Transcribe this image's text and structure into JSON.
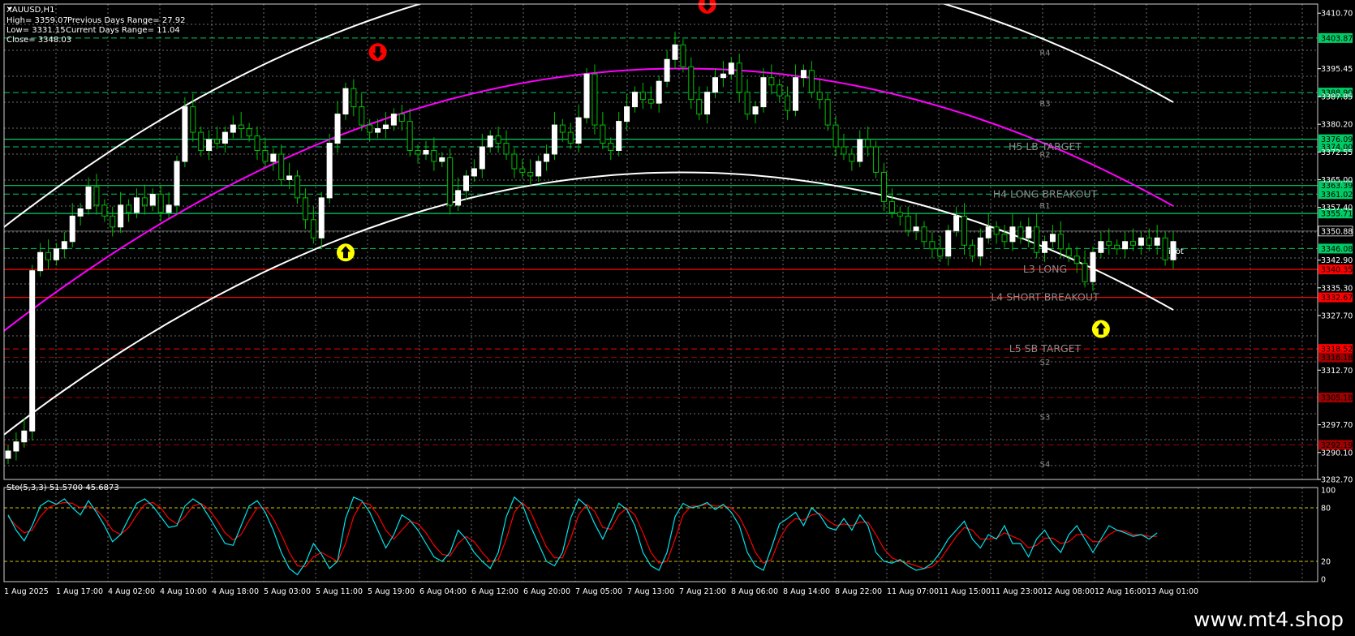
{
  "window": {
    "symbol_title": "XAUUSD,H1"
  },
  "info_panel": {
    "high": "High= 3359.07",
    "prev_range": "Previous Days Range= 27.92",
    "low": "Low= 3331.15",
    "current_range": "Current Days Range= 11.04",
    "close": "Close= 3348.03"
  },
  "indicator": {
    "label": "Sto(5,3,3) 51.5700 45.6873"
  },
  "watermark": "www.mt4.shop",
  "colors": {
    "background": "#000000",
    "grid": "#c8c8c8",
    "candle": "#ffffff",
    "candle_wick": "#00c000",
    "channel_upper": "#ffffff",
    "regression": "#ff00ff",
    "level_green": "#00cc66",
    "level_red": "#ff0000",
    "level_dark_red": "#a00000",
    "stoch_main": "#00e5ee",
    "stoch_signal": "#ff0000",
    "stoch_level": "#c8c800"
  },
  "chart_data": [
    {
      "type": "candlestick",
      "symbol": "XAUUSD",
      "timeframe": "H1",
      "ylim": [
        3282.7,
        3413.2
      ],
      "price_ticks": [
        "3410.70",
        "3395.45",
        "3387.85",
        "3380.20",
        "3372.55",
        "3365.00",
        "3357.40",
        "3342.90",
        "3335.30",
        "3327.70",
        "3312.70",
        "3297.70",
        "3290.10",
        "3282.70"
      ],
      "x_ticks": [
        "1 Aug 2025",
        "1 Aug 17:00",
        "4 Aug 02:00",
        "4 Aug 10:00",
        "4 Aug 18:00",
        "5 Aug 03:00",
        "5 Aug 11:00",
        "5 Aug 19:00",
        "6 Aug 04:00",
        "6 Aug 12:00",
        "6 Aug 20:00",
        "7 Aug 05:00",
        "7 Aug 13:00",
        "7 Aug 21:00",
        "8 Aug 06:00",
        "8 Aug 14:00",
        "8 Aug 22:00",
        "11 Aug 07:00",
        "11 Aug 15:00",
        "11 Aug 23:00",
        "12 Aug 08:00",
        "12 Aug 16:00",
        "13 Aug 01:00"
      ],
      "price_levels": [
        {
          "value": "3403.87",
          "color": "#00cc66",
          "style": "dash"
        },
        {
          "value": "3388.90",
          "color": "#00cc66",
          "style": "dash"
        },
        {
          "value": "3376.09",
          "color": "#00cc66",
          "style": "solid"
        },
        {
          "value": "3374.00",
          "color": "#00cc66",
          "style": "dash"
        },
        {
          "value": "3363.39",
          "color": "#00cc66",
          "style": "solid"
        },
        {
          "value": "3361.02",
          "color": "#00cc66",
          "style": "dash"
        },
        {
          "value": "3355.71",
          "color": "#00cc66",
          "style": "solid"
        },
        {
          "value": "3350.88",
          "color": "#ffffff",
          "style": "current"
        },
        {
          "value": "3346.08",
          "color": "#00cc66",
          "style": "dash"
        },
        {
          "value": "3340.35",
          "color": "#ff0000",
          "style": "solid"
        },
        {
          "value": "3332.67",
          "color": "#ff0000",
          "style": "solid"
        },
        {
          "value": "3318.52",
          "color": "#ff0000",
          "style": "dash"
        },
        {
          "value": "3316.18",
          "color": "#a00000",
          "style": "dash"
        },
        {
          "value": "3305.18",
          "color": "#a00000",
          "style": "dash"
        },
        {
          "value": "3292.19",
          "color": "#a00000",
          "style": "dash"
        }
      ],
      "level_labels": [
        "H5 LB TARGET",
        "H4 LONG BREAKOUT",
        "L3 LONG",
        "L4 SHORT BREAKOUT",
        "L5 SB TARGET"
      ],
      "pivot_labels": [
        "R4",
        "R3",
        "R2",
        "R1",
        "S2",
        "S3",
        "S4",
        "ivot"
      ],
      "series": [
        {
          "kind": "close",
          "values": [
            3290.5,
            3293.0,
            3296.0,
            3340.0,
            3345.0,
            3343.0,
            3346.0,
            3348.0,
            3355.0,
            3357.0,
            3363.0,
            3358.0,
            3355.0,
            3352.0,
            3358.0,
            3356.0,
            3360.0,
            3358.0,
            3361.0,
            3356.0,
            3358.0,
            3370.0,
            3385.0,
            3378.0,
            3373.0,
            3376.0,
            3375.0,
            3378.0,
            3380.0,
            3379.0,
            3377.0,
            3373.0,
            3370.0,
            3372.0,
            3365.0,
            3366.0,
            3360.0,
            3354.0,
            3349.0,
            3360.0,
            3375.0,
            3383.0,
            3390.0,
            3385.0,
            3380.0,
            3378.0,
            3379.0,
            3380.0,
            3383.0,
            3381.0,
            3373.0,
            3372.0,
            3373.0,
            3370.0,
            3371.0,
            3358.0,
            3362.0,
            3366.0,
            3368.0,
            3374.0,
            3377.0,
            3375.0,
            3372.0,
            3368.0,
            3367.0,
            3366.0,
            3370.0,
            3372.0,
            3380.0,
            3378.0,
            3375.0,
            3382.0,
            3394.0,
            3380.0,
            3375.0,
            3373.0,
            3381.0,
            3385.0,
            3389.0,
            3387.0,
            3386.0,
            3392.0,
            3398.0,
            3402.0,
            3396.0,
            3387.0,
            3383.0,
            3389.0,
            3393.0,
            3394.0,
            3397.0,
            3389.0,
            3383.0,
            3385.0,
            3393.0,
            3391.0,
            3388.0,
            3384.0,
            3393.0,
            3395.0,
            3389.0,
            3387.0,
            3380.0,
            3374.0,
            3372.0,
            3370.0,
            3376.0,
            3374.0,
            3367.0,
            3359.0,
            3356.0,
            3355.0,
            3351.0,
            3352.0,
            3348.0,
            3346.0,
            3344.0,
            3351.0,
            3355.0,
            3347.0,
            3344.0,
            3349.0,
            3352.0,
            3350.0,
            3348.0,
            3352.0,
            3349.0,
            3352.0,
            3345.0,
            3348.0,
            3350.0,
            3346.0,
            3344.0,
            3342.0,
            3337.0,
            3345.0,
            3348.0,
            3347.0,
            3346.0,
            3348.0,
            3347.0,
            3349.0,
            3347.0,
            3349.0,
            3343.0,
            3348.0
          ]
        },
        {
          "kind": "stochastic_main",
          "name": "Sto(5,3,3)",
          "values": [
            72,
            55,
            43,
            60,
            82,
            88,
            84,
            90,
            80,
            72,
            88,
            75,
            60,
            42,
            50,
            68,
            85,
            90,
            82,
            70,
            58,
            60,
            82,
            90,
            84,
            70,
            55,
            40,
            38,
            60,
            82,
            88,
            75,
            55,
            30,
            12,
            5,
            18,
            40,
            28,
            12,
            20,
            68,
            92,
            88,
            75,
            55,
            35,
            50,
            72,
            66,
            55,
            40,
            25,
            20,
            30,
            55,
            45,
            30,
            20,
            12,
            30,
            70,
            92,
            84,
            60,
            40,
            20,
            15,
            30,
            68,
            90,
            82,
            62,
            45,
            65,
            85,
            78,
            60,
            30,
            15,
            10,
            30,
            70,
            85,
            80,
            82,
            86,
            78,
            84,
            75,
            60,
            30,
            15,
            10,
            35,
            62,
            68,
            75,
            60,
            80,
            72,
            58,
            55,
            68,
            55,
            72,
            60,
            30,
            20,
            18,
            22,
            15,
            10,
            12,
            18,
            30,
            45,
            55,
            65,
            45,
            35,
            50,
            45,
            60,
            40,
            40,
            25,
            45,
            55,
            40,
            30,
            50,
            60,
            45,
            30,
            45,
            60,
            55,
            52,
            48,
            50,
            45,
            52
          ]
        },
        {
          "kind": "stochastic_signal",
          "values": [
            70,
            60,
            52,
            55,
            70,
            80,
            84,
            86,
            85,
            80,
            82,
            78,
            68,
            55,
            50,
            58,
            72,
            84,
            86,
            80,
            68,
            62,
            70,
            82,
            85,
            78,
            66,
            52,
            44,
            50,
            66,
            80,
            80,
            68,
            50,
            30,
            15,
            14,
            25,
            30,
            25,
            20,
            40,
            70,
            86,
            84,
            72,
            55,
            45,
            55,
            65,
            62,
            52,
            38,
            28,
            26,
            40,
            48,
            42,
            30,
            20,
            22,
            45,
            75,
            86,
            76,
            56,
            36,
            24,
            24,
            45,
            72,
            84,
            76,
            58,
            56,
            72,
            80,
            72,
            52,
            30,
            18,
            20,
            45,
            72,
            82,
            82,
            84,
            82,
            82,
            80,
            70,
            52,
            30,
            18,
            22,
            45,
            60,
            68,
            66,
            72,
            74,
            66,
            60,
            62,
            60,
            64,
            64,
            50,
            34,
            24,
            20,
            18,
            15,
            12,
            14,
            22,
            35,
            48,
            58,
            55,
            45,
            45,
            46,
            52,
            48,
            44,
            35,
            38,
            46,
            46,
            40,
            42,
            50,
            50,
            42,
            42,
            50,
            55,
            54,
            50,
            50,
            48,
            48
          ]
        }
      ],
      "stochastic": {
        "ylim": [
          0,
          100
        ],
        "levels": [
          20,
          80
        ],
        "ticks": [
          "100",
          "80",
          "20",
          "0"
        ]
      },
      "markers": [
        {
          "kind": "sell-signal",
          "x_index": 46,
          "value": 3400.0,
          "color": "#ff0000"
        },
        {
          "kind": "sell-signal",
          "x_index": 87,
          "value": 3413.0,
          "color": "#ff0000"
        },
        {
          "kind": "buy-signal",
          "x_index": 42,
          "value": 3345.0,
          "color": "#ffff00"
        },
        {
          "kind": "buy-signal",
          "x_index": 136,
          "value": 3324.0,
          "color": "#ffff00"
        }
      ]
    }
  ]
}
